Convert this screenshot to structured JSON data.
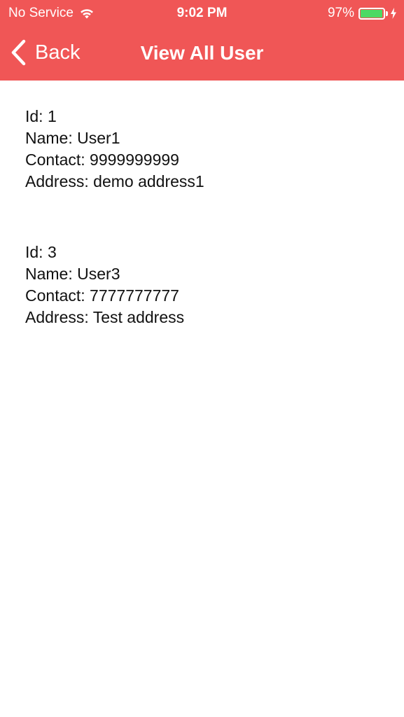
{
  "status_bar": {
    "carrier": "No Service",
    "time": "9:02 PM",
    "battery_percent": "97%",
    "battery_level": 0.97,
    "battery_color": "#4CD964"
  },
  "nav": {
    "back_label": "Back",
    "title": "View All User",
    "bar_color": "#F05656"
  },
  "users": [
    {
      "id": "Id: 1",
      "name": "Name: User1",
      "contact": "Contact: 9999999999",
      "address": "Address: demo address1"
    },
    {
      "id": "Id: 3",
      "name": "Name: User3",
      "contact": "Contact: 7777777777",
      "address": "Address: Test address"
    }
  ]
}
